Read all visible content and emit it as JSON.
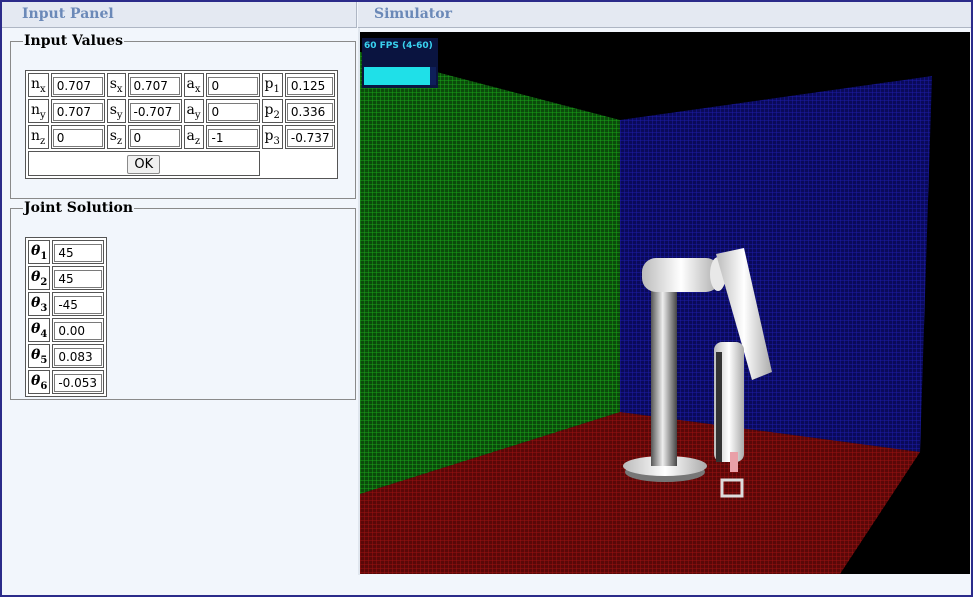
{
  "panels": {
    "input_panel_title": "Input Panel",
    "simulator_title": "Simulator"
  },
  "input_values": {
    "legend": "Input Values",
    "rows": [
      [
        {
          "base": "n",
          "sub": "x",
          "value": "0.707"
        },
        {
          "base": "s",
          "sub": "x",
          "value": "0.707"
        },
        {
          "base": "a",
          "sub": "x",
          "value": "0"
        },
        {
          "base": "p",
          "sub": "1",
          "value": "0.125"
        }
      ],
      [
        {
          "base": "n",
          "sub": "y",
          "value": "0.707"
        },
        {
          "base": "s",
          "sub": "y",
          "value": "-0.707"
        },
        {
          "base": "a",
          "sub": "y",
          "value": "0"
        },
        {
          "base": "p",
          "sub": "2",
          "value": "0.336"
        }
      ],
      [
        {
          "base": "n",
          "sub": "z",
          "value": "0"
        },
        {
          "base": "s",
          "sub": "z",
          "value": "0"
        },
        {
          "base": "a",
          "sub": "z",
          "value": "-1"
        },
        {
          "base": "p",
          "sub": "3",
          "value": "-0.737"
        }
      ]
    ],
    "ok_label": "OK"
  },
  "joint_solution": {
    "legend": "Joint Solution",
    "symbol": "θ",
    "rows": [
      {
        "sub": "1",
        "value": "45"
      },
      {
        "sub": "2",
        "value": "45"
      },
      {
        "sub": "3",
        "value": "-45"
      },
      {
        "sub": "4",
        "value": "0.00"
      },
      {
        "sub": "5",
        "value": "0.083"
      },
      {
        "sub": "6",
        "value": "-0.053"
      }
    ]
  },
  "simulator": {
    "fps_text": "60 FPS (4-60)",
    "fps_fraction": 0.92,
    "colors": {
      "left_wall": "#1a8a1a",
      "back_wall": "#14148c",
      "floor": "#8a1010",
      "background": "#000000"
    }
  }
}
